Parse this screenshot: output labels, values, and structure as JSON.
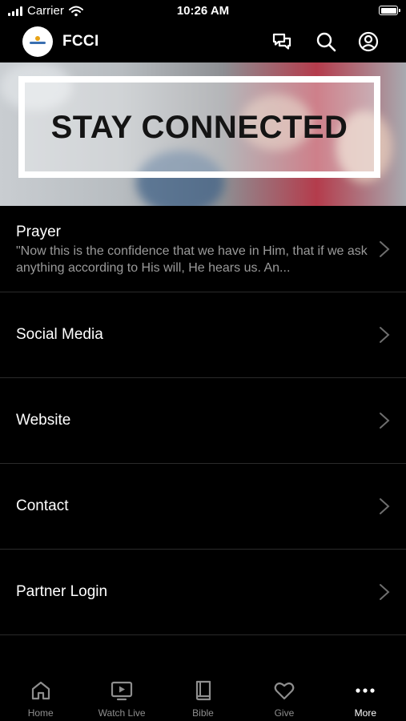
{
  "status_bar": {
    "carrier": "Carrier",
    "time": "10:26 AM"
  },
  "header": {
    "title": "FCCI",
    "icons": [
      "chat-icon",
      "search-icon",
      "profile-icon"
    ]
  },
  "banner": {
    "text": "STAY CONNECTED"
  },
  "menu": {
    "items": [
      {
        "title": "Prayer",
        "subtitle": "\"Now this is the confidence that we have in Him, that if we ask anything according to His will, He hears us. An..."
      },
      {
        "title": "Social Media"
      },
      {
        "title": "Website"
      },
      {
        "title": "Contact"
      },
      {
        "title": "Partner Login"
      }
    ]
  },
  "tabs": [
    {
      "label": "Home",
      "icon": "home-icon"
    },
    {
      "label": "Watch Live",
      "icon": "tv-play-icon"
    },
    {
      "label": "Bible",
      "icon": "book-icon"
    },
    {
      "label": "Give",
      "icon": "heart-icon"
    },
    {
      "label": "More",
      "icon": "more-dots-icon",
      "active": true
    }
  ],
  "colors": {
    "background": "#000000",
    "text": "#ffffff",
    "muted": "#9a9a9a",
    "divider": "#2a2a2a",
    "inactive_tab": "#8e8e8e"
  }
}
